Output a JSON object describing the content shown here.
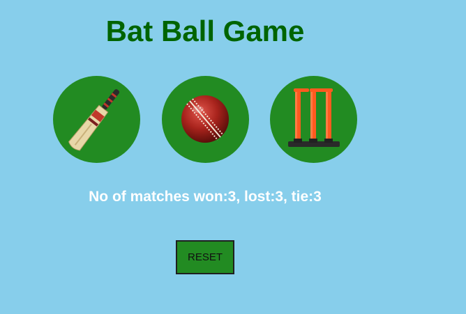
{
  "app": {
    "title": "Bat Ball Game"
  },
  "choices": [
    {
      "name": "bat",
      "icon": "cricket-bat-icon"
    },
    {
      "name": "ball",
      "icon": "cricket-ball-icon"
    },
    {
      "name": "stump",
      "icon": "cricket-stumps-icon"
    }
  ],
  "score": {
    "text": "No of matches won:3, lost:3, tie:3",
    "won": 3,
    "lost": 3,
    "tie": 3
  },
  "controls": {
    "reset_label": "RESET"
  },
  "colors": {
    "background": "#87ceeb",
    "title": "#006400",
    "circle": "#228b22",
    "score_text": "#ffffff",
    "button": "#228b22"
  }
}
